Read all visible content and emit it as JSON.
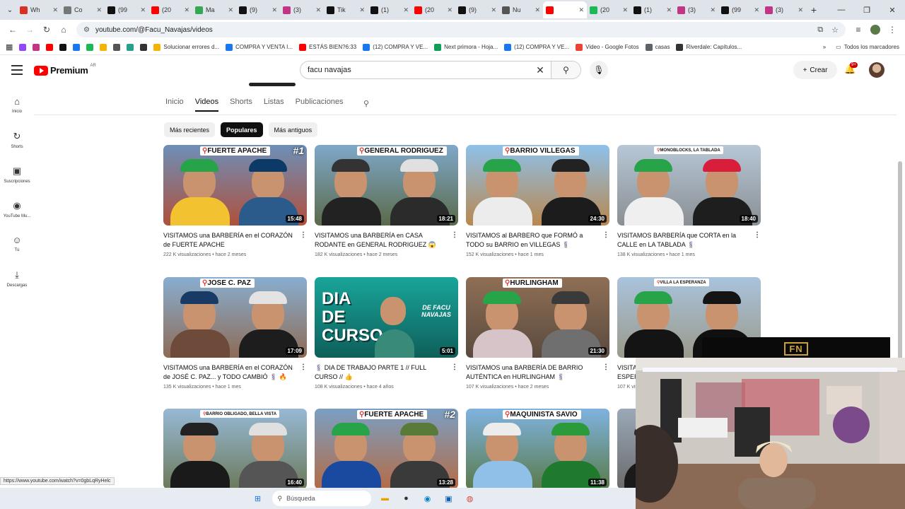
{
  "browser": {
    "tabs": [
      {
        "label": "Wh",
        "color": "#d93025"
      },
      {
        "label": "Co",
        "color": "#777777"
      },
      {
        "label": "(99",
        "color": "#111111"
      },
      {
        "label": "(20",
        "color": "#ff0000"
      },
      {
        "label": "Ma",
        "color": "#34a853"
      },
      {
        "label": "(9)",
        "color": "#111111"
      },
      {
        "label": "(3)",
        "color": "#c13584"
      },
      {
        "label": "Tik",
        "color": "#111111"
      },
      {
        "label": "(1)",
        "color": "#111111"
      },
      {
        "label": "(20",
        "color": "#ff0000"
      },
      {
        "label": "(9)",
        "color": "#111111"
      },
      {
        "label": "Nu",
        "color": "#555555"
      },
      {
        "label": "",
        "color": "#ff0000",
        "active": true
      },
      {
        "label": "(20",
        "color": "#1db954"
      },
      {
        "label": "(1)",
        "color": "#111111"
      },
      {
        "label": "(3)",
        "color": "#c13584"
      },
      {
        "label": "(99",
        "color": "#111111"
      },
      {
        "label": "(3)",
        "color": "#c13584"
      }
    ],
    "url": "youtube.com/@Facu_Navajas/videos",
    "bookmarks": [
      {
        "label": "",
        "color": "#9146ff"
      },
      {
        "label": "",
        "color": "#c13584"
      },
      {
        "label": "",
        "color": "#ff0000"
      },
      {
        "label": "",
        "color": "#111111"
      },
      {
        "label": "",
        "color": "#1877f2"
      },
      {
        "label": "",
        "color": "#1db954"
      },
      {
        "label": "",
        "color": "#f4b400"
      },
      {
        "label": "",
        "color": "#555555"
      },
      {
        "label": "",
        "color": "#25a18e"
      },
      {
        "label": "",
        "color": "#333333"
      },
      {
        "label": "Solucionar errores d...",
        "color": "#f4b400"
      },
      {
        "label": "COMPRA Y VENTA I...",
        "color": "#1877f2"
      },
      {
        "label": "ESTÁS BIEN?6:33",
        "color": "#ff0000"
      },
      {
        "label": "(12) COMPRA Y VE...",
        "color": "#1877f2"
      },
      {
        "label": "Next primora - Hoja...",
        "color": "#0f9d58"
      },
      {
        "label": "(12) COMPRA Y VE...",
        "color": "#1877f2"
      },
      {
        "label": "Video - Google Fotos",
        "color": "#ea4335"
      },
      {
        "label": "casas",
        "color": "#5f6368"
      },
      {
        "label": "Riverdale: Capítulos...",
        "color": "#333333"
      }
    ],
    "bookmarks_all": "Todos los marcadores",
    "status_url": "https://www.youtube.com/watch?v=0gbLqRyHelc"
  },
  "youtube": {
    "logo_text": "Premium",
    "logo_region": "AR",
    "search_query": "facu navajas",
    "create_label": "Crear",
    "notif_badge": "9+",
    "guide": [
      {
        "label": "Inicio",
        "icon": "⌂"
      },
      {
        "label": "Shorts",
        "icon": "↻"
      },
      {
        "label": "Suscripciones",
        "icon": "▣"
      },
      {
        "label": "YouTube Mu...",
        "icon": "◉"
      },
      {
        "label": "Tú",
        "icon": "☺"
      },
      {
        "label": "Descargas",
        "icon": "⤓"
      }
    ],
    "subtabs": [
      "Inicio",
      "Videos",
      "Shorts",
      "Listas",
      "Publicaciones"
    ],
    "active_subtab": "Videos",
    "chips": [
      "Más recientes",
      "Populares",
      "Más antiguos"
    ],
    "active_chip": "Populares",
    "videos": [
      {
        "tag": "FUERTE APACHE",
        "num": "#1",
        "duration": "15:48",
        "title": "VISITAMOS una BARBERÍA en el CORAZÓN de FUERTE APACHE",
        "info": "222 K visualizaciones • hace 2 meses",
        "bg": [
          "#6d8fb8",
          "#b0503c"
        ],
        "c1": [
          "#27a34a",
          "#f2c230"
        ],
        "c2": [
          "#0b3a66",
          "#2a5b8a"
        ]
      },
      {
        "tag": "GENERAL RODRIGUEZ",
        "num": "",
        "duration": "18:21",
        "title": "VISITAMOS una BARBERÍA en CASA RODANTE en GENERAL RODRIGUEZ 😱",
        "info": "182 K visualizaciones • hace 2 meses",
        "bg": [
          "#7fa8c9",
          "#5a6a4a"
        ],
        "c1": [
          "#333333",
          "#222222"
        ],
        "c2": [
          "#e0e0e0",
          "#2b2b2b"
        ]
      },
      {
        "tag": "BARRIO VILLEGAS",
        "num": "",
        "duration": "24:30",
        "title": "VISITAMOS al BARBERO que FORMÓ a TODO su BARRIO en VILLEGAS 💈",
        "info": "152 K visualizaciones • hace 1 mes",
        "bg": [
          "#8ec1ea",
          "#b9874f"
        ],
        "c1": [
          "#27a34a",
          "#ececec"
        ],
        "c2": [
          "#222222",
          "#1c1c1c"
        ]
      },
      {
        "tag": "MONOBLOCKS, LA TABLADA",
        "num": "",
        "small": true,
        "duration": "18:40",
        "title": "VISITAMOS BARBERÍA que CORTA en la CALLE en LA TABLADA 💈",
        "info": "138 K visualizaciones • hace 1 mes",
        "bg": [
          "#b7c7d6",
          "#8a8f93"
        ],
        "c1": [
          "#27a34a",
          "#efefef"
        ],
        "c2": [
          "#d81e3a",
          "#1e1e1e"
        ]
      },
      {
        "tag": "JOSE C. PAZ",
        "num": "",
        "duration": "17:09",
        "title": "VISITAMOS una BARBERÍA en el CORAZÓN de JOSÉ C. PAZ... y TODO CAMBIÓ 💈 🔥",
        "info": "135 K visualizaciones • hace 1 mes",
        "bg": [
          "#88aed0",
          "#8e6b55"
        ],
        "c1": [
          "#1a3a66",
          "#6e4a3a"
        ],
        "c2": [
          "#e3e3e3",
          "#1d1d1d"
        ]
      },
      {
        "tag": "",
        "num": "",
        "duration": "5:01",
        "title": "💈 DIA DE TRABAJO PARTE 1 // FULL CURSO // 👍",
        "info": "108 K visualizaciones • hace 4 años",
        "bg": [
          "#19a59a",
          "#0e5f5a"
        ],
        "c1": [
          "#19a59a",
          "#19a59a"
        ],
        "c2": [
          "#3a8a7a",
          "#2a4a4a"
        ],
        "banner": "DIA DE CURSO",
        "banner2": "DE FACU NAVAJAS"
      },
      {
        "tag": "HURLINGHAM",
        "num": "",
        "duration": "21:30",
        "title": "VISITAMOS una BARBERÍA DE BARRIO AUTÉNTICA en HURLINGHAM 💈",
        "info": "107 K visualizaciones • hace 2 meses",
        "bg": [
          "#8f6f55",
          "#5a4a3e"
        ],
        "c1": [
          "#27a34a",
          "#d7c4c8"
        ],
        "c2": [
          "#3a3a3a",
          "#6f6f6f"
        ]
      },
      {
        "tag": "VILLA LA ESPERANZA",
        "num": "",
        "small": true,
        "duration": "",
        "title": "VISITAMOS una BARBERÍA en VILLA LA ESPERANZA",
        "info": "107 K visualizaciones",
        "bg": [
          "#a9c3dd",
          "#9a9a8a"
        ],
        "c1": [
          "#27a34a",
          "#141414"
        ],
        "c2": [
          "#141414",
          "#101010"
        ]
      },
      {
        "tag": "BARRIO OBLIGADO, BELLA VISTA",
        "num": "",
        "small": true,
        "duration": "16:40",
        "title": "",
        "info": "",
        "bg": [
          "#97b9d6",
          "#6c7a5a"
        ],
        "c1": [
          "#222222",
          "#1a1a1a"
        ],
        "c2": [
          "#e0e0e0",
          "#555555"
        ]
      },
      {
        "tag": "FUERTE APACHE",
        "num": "#2",
        "duration": "13:28",
        "title": "",
        "info": "",
        "bg": [
          "#7a9fc4",
          "#b56b45"
        ],
        "c1": [
          "#27a34a",
          "#1a4aa0"
        ],
        "c2": [
          "#5a7a3a",
          "#3a3a3a"
        ]
      },
      {
        "tag": "MAQUINISTA SAVIO",
        "num": "",
        "duration": "11:38",
        "title": "",
        "info": "",
        "bg": [
          "#7fb3e0",
          "#5a7a4a"
        ],
        "c1": [
          "#ececec",
          "#90c0e8"
        ],
        "c2": [
          "#2a9a3a",
          "#1f7a2e"
        ]
      },
      {
        "tag": "",
        "num": "",
        "duration": "",
        "title": "",
        "info": "",
        "bg": [
          "#9aa9b8",
          "#6a6a6a"
        ],
        "c1": [
          "#2a2a2a",
          "#1a1a1a"
        ],
        "c2": [
          "#9aa9b8",
          "#6a6a6a"
        ]
      }
    ]
  },
  "overlay": {
    "brand": "FN"
  },
  "taskbar": {
    "search_placeholder": "Búsqueda"
  }
}
